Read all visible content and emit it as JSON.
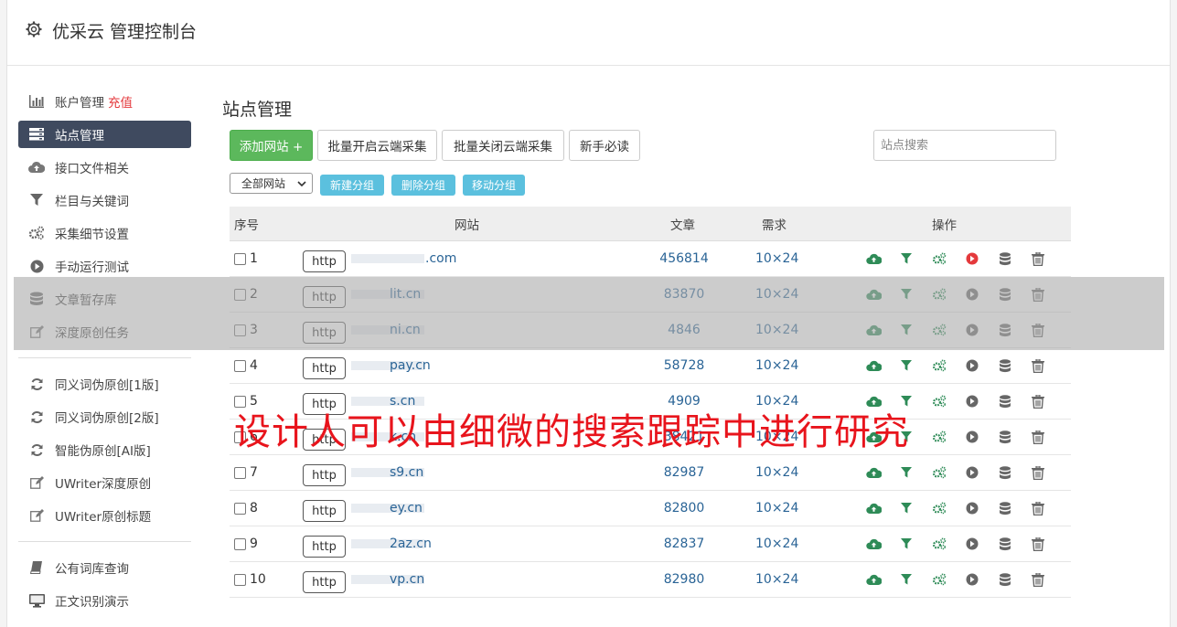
{
  "app": {
    "title": "优采云 管理控制台"
  },
  "sidebar": {
    "items": [
      {
        "label": "账户管理",
        "extra": "充值",
        "icon": "bar-chart-icon"
      },
      {
        "label": "站点管理",
        "icon": "server-icon",
        "active": true
      },
      {
        "label": "接口文件相关",
        "icon": "cloud-upload-icon"
      },
      {
        "label": "栏目与关键词",
        "icon": "filter-icon"
      },
      {
        "label": "采集细节设置",
        "icon": "cogs-icon"
      },
      {
        "label": "手动运行测试",
        "icon": "play-circle-icon"
      },
      {
        "label": "文章暂存库",
        "icon": "database-icon"
      },
      {
        "label": "深度原创任务",
        "icon": "edit-icon"
      }
    ],
    "items2": [
      {
        "label": "同义词伪原创[1版]",
        "icon": "refresh-icon"
      },
      {
        "label": "同义词伪原创[2版]",
        "icon": "refresh-icon"
      },
      {
        "label": "智能伪原创[AI版]",
        "icon": "refresh-icon"
      },
      {
        "label": "UWriter深度原创",
        "icon": "edit-icon"
      },
      {
        "label": "UWriter原创标题",
        "icon": "edit-icon"
      }
    ],
    "items3": [
      {
        "label": "公有词库查询",
        "icon": "book-icon"
      },
      {
        "label": "正文识别演示",
        "icon": "monitor-icon"
      }
    ]
  },
  "main": {
    "title": "站点管理",
    "toolbar": {
      "add_site": "添加网站 +",
      "batch_open": "批量开启云端采集",
      "batch_close": "批量关闭云端采集",
      "newbie": "新手必读"
    },
    "search_placeholder": "站点搜索",
    "group_select": "全部网站",
    "group_buttons": {
      "new": "新建分组",
      "delete": "删除分组",
      "move": "移动分组"
    },
    "table": {
      "headers": {
        "index": "序号",
        "site": "网站",
        "articles": "文章",
        "demand": "需求",
        "ops": "操作"
      },
      "http_label": "http",
      "rows": [
        {
          "index": "1",
          "site": ".com",
          "articles": "456814",
          "demand": "10×24"
        },
        {
          "index": "2",
          "site": "lit.cn",
          "articles": "83870",
          "demand": "10×24"
        },
        {
          "index": "3",
          "site": "ni.cn",
          "articles": "4846",
          "demand": "10×24"
        },
        {
          "index": "4",
          "site": "pay.cn",
          "articles": "58728",
          "demand": "10×24"
        },
        {
          "index": "5",
          "site": "s.cn",
          "articles": "4909",
          "demand": "10×24"
        },
        {
          "index": "6",
          "site": "k.cn",
          "articles": "38421",
          "demand": "10×24"
        },
        {
          "index": "7",
          "site": "s9.cn",
          "articles": "82987",
          "demand": "10×24"
        },
        {
          "index": "8",
          "site": "ey.cn",
          "articles": "82800",
          "demand": "10×24"
        },
        {
          "index": "9",
          "site": "2az.cn",
          "articles": "82837",
          "demand": "10×24"
        },
        {
          "index": "10",
          "site": "vp.cn",
          "articles": "82980",
          "demand": "10×24"
        }
      ]
    }
  },
  "overlay_caption": "设计人可以由细微的搜索跟踪中进行研究",
  "colors": {
    "green": "#5cb85c",
    "info": "#5bc0de",
    "nav_active": "#3f4a5f",
    "link": "#2a6496",
    "icon_green": "#2e8b57",
    "icon_red": "#e4393c",
    "caption": "#e8141c"
  }
}
